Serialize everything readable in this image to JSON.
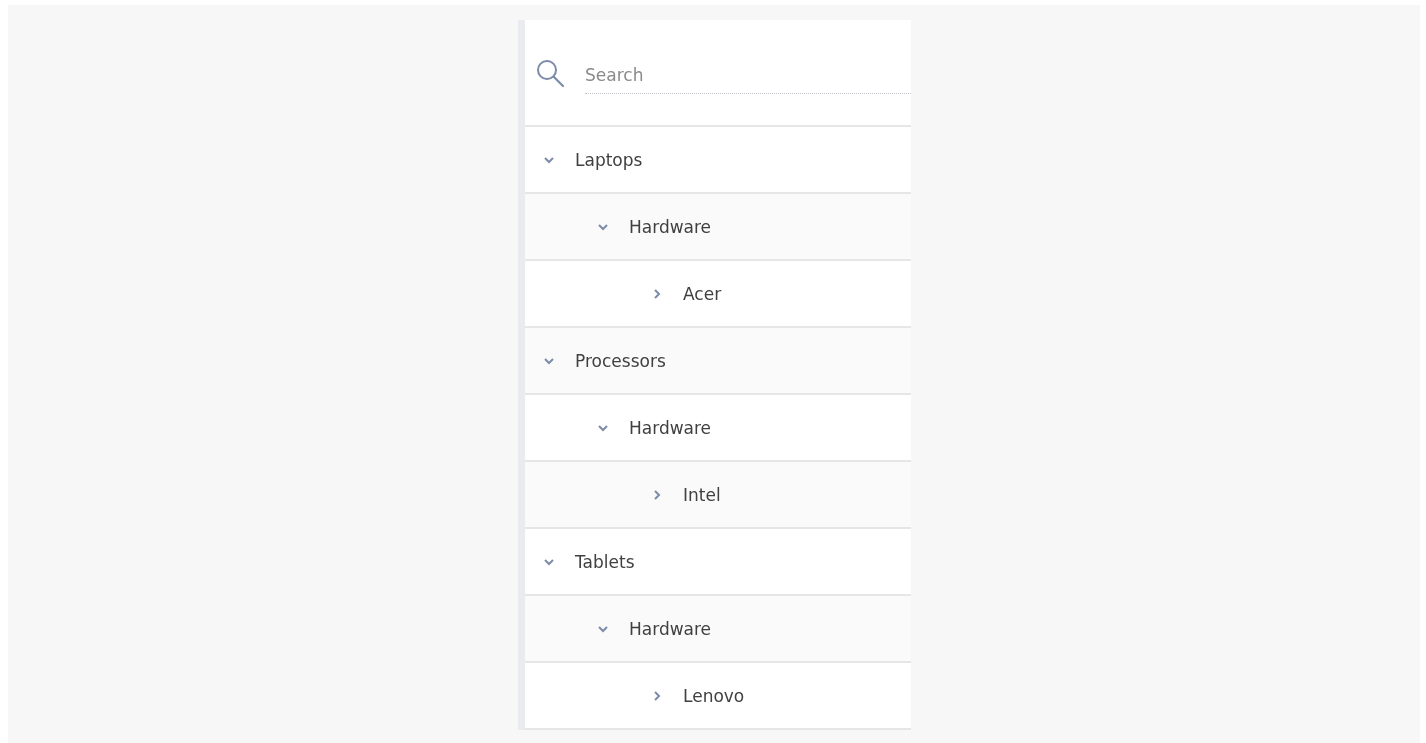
{
  "search": {
    "placeholder": "Search"
  },
  "tree": [
    {
      "label": "Laptops",
      "expanded": true,
      "children": [
        {
          "label": "Hardware",
          "expanded": true,
          "children": [
            {
              "label": "Acer",
              "expanded": false
            }
          ]
        }
      ]
    },
    {
      "label": "Processors",
      "expanded": true,
      "children": [
        {
          "label": "Hardware",
          "expanded": true,
          "children": [
            {
              "label": "Intel",
              "expanded": false
            }
          ]
        }
      ]
    },
    {
      "label": "Tablets",
      "expanded": true,
      "children": [
        {
          "label": "Hardware",
          "expanded": true,
          "children": [
            {
              "label": "Lenovo",
              "expanded": false
            }
          ]
        }
      ]
    }
  ]
}
